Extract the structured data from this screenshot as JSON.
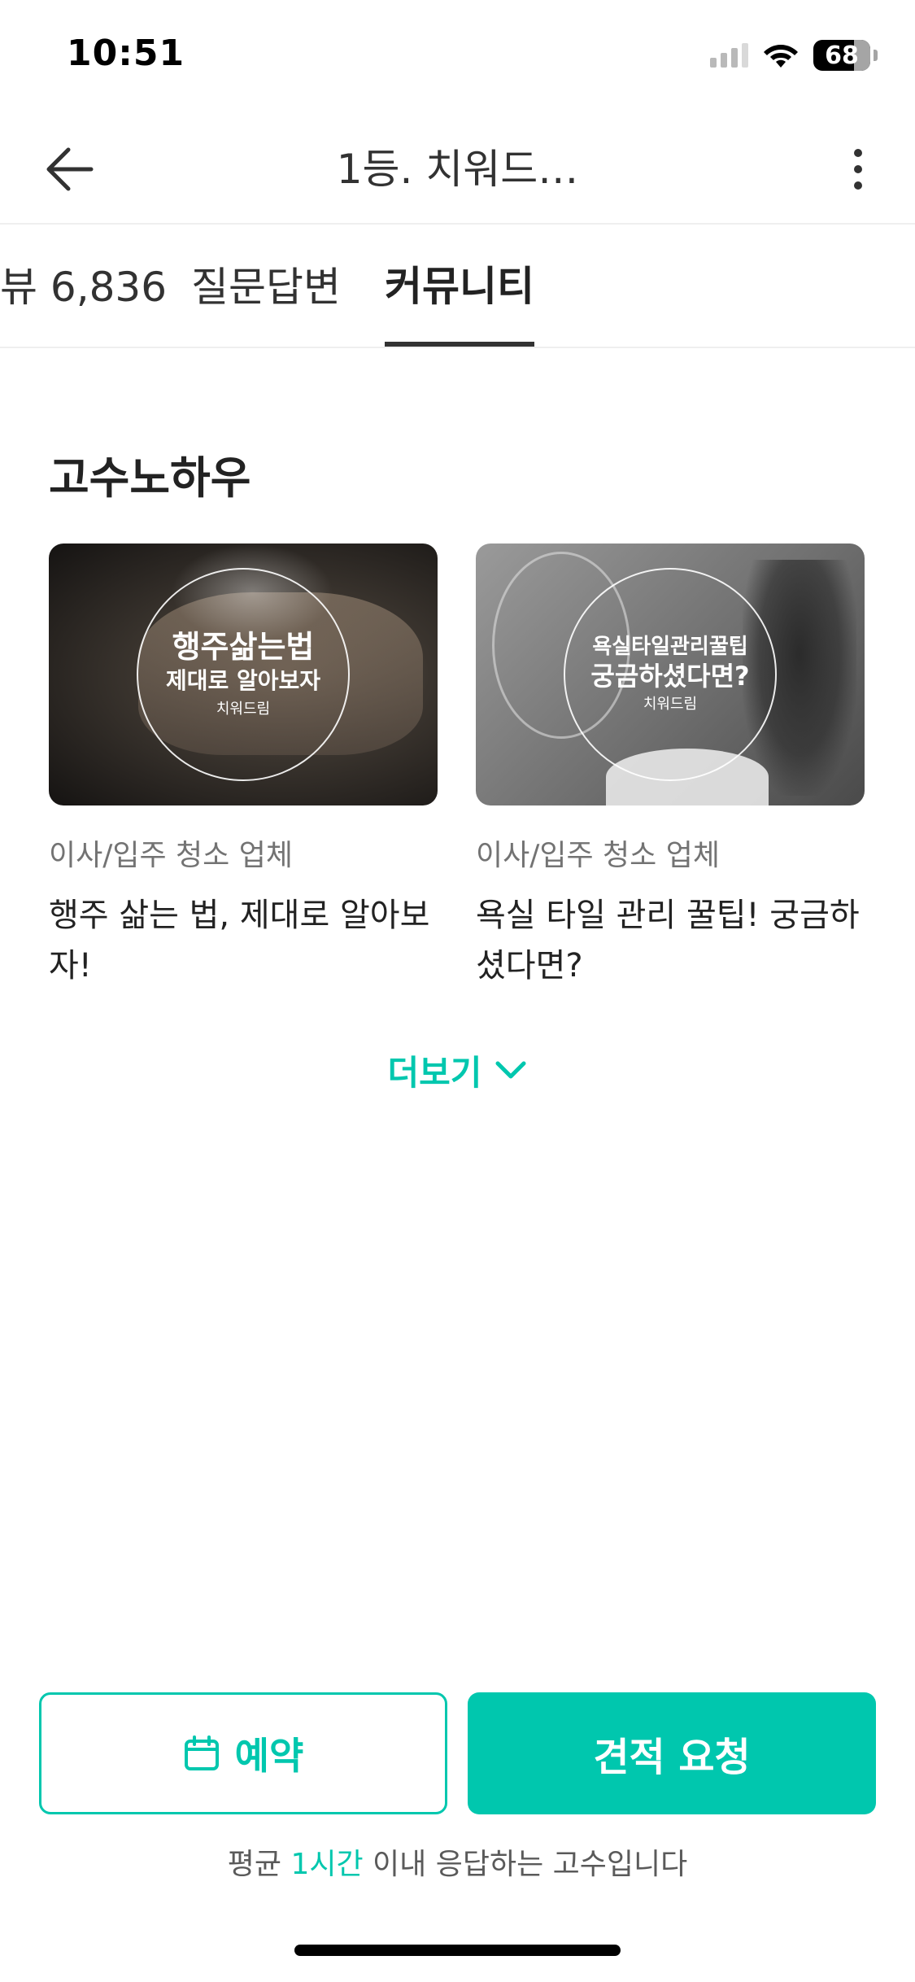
{
  "status_bar": {
    "time": "10:51",
    "battery": "68"
  },
  "header": {
    "title": "1등. 치워드…",
    "back_icon": "arrow-left-icon",
    "more_icon": "more-vertical-icon"
  },
  "tabs": [
    {
      "label": "뷰 6,836",
      "active": false
    },
    {
      "label": "질문답변",
      "active": false
    },
    {
      "label": "커뮤니티",
      "active": true
    }
  ],
  "section": {
    "title": "고수노하우",
    "cards": [
      {
        "thumb_line1": "행주삶는법",
        "thumb_line2": "제대로 알아보자",
        "thumb_brand": "치워드림",
        "category": "이사/입주 청소 업체",
        "title": "행주 삶는 법, 제대로 알아보자!"
      },
      {
        "thumb_line1": "욕실타일관리꿀팁",
        "thumb_line2": "궁금하셨다면?",
        "thumb_brand": "치워드림",
        "category": "이사/입주 청소 업체",
        "title": "욕실 타일 관리 꿀팁! 궁금하셨다면?"
      }
    ],
    "more_label": "더보기"
  },
  "bottom": {
    "reserve_label": "예약",
    "quote_label": "견적 요청",
    "note_prefix": "평균 ",
    "note_highlight": "1시간",
    "note_suffix": " 이내 응답하는 고수입니다"
  },
  "colors": {
    "accent": "#00c7ae",
    "text": "#323232",
    "muted": "#737373"
  }
}
